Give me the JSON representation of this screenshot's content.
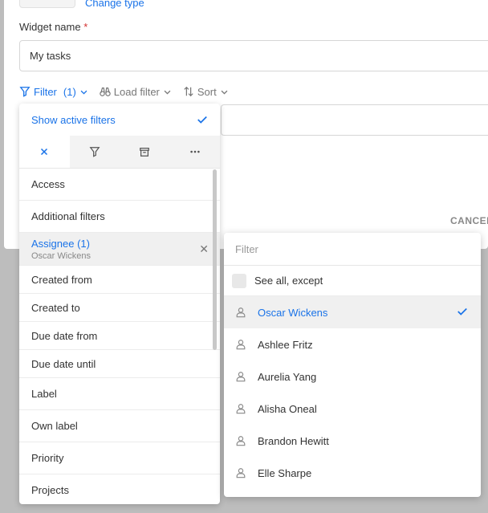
{
  "dialog": {
    "change_type_link": "Change type",
    "widget_name_label": "Widget name",
    "required_marker": "*",
    "widget_name_value": "My tasks",
    "cancel_button": "CANCEL"
  },
  "toolbar": {
    "filter_label": "Filter",
    "filter_count": "(1)",
    "load_filter_label": "Load filter",
    "sort_label": "Sort"
  },
  "filter_panel": {
    "show_active_label": "Show active filters",
    "tabs": [
      "close-icon",
      "filter-icon",
      "archive-icon",
      "more-icon"
    ],
    "items": [
      {
        "label": "Access"
      },
      {
        "label": "Additional filters"
      },
      {
        "label": "Assignee (1)",
        "sub": "Oscar Wickens"
      },
      {
        "label": "Created from"
      },
      {
        "label": "Created to"
      },
      {
        "label": "Due date from"
      },
      {
        "label": "Due date until"
      },
      {
        "label": "Label"
      },
      {
        "label": "Own label"
      },
      {
        "label": "Priority"
      },
      {
        "label": "Projects"
      }
    ]
  },
  "assignee_dropdown": {
    "search_placeholder": "Filter",
    "see_all_except_label": "See all, except",
    "users": [
      {
        "name": "Oscar Wickens",
        "selected": true
      },
      {
        "name": "Ashlee Fritz",
        "selected": false
      },
      {
        "name": "Aurelia Yang",
        "selected": false
      },
      {
        "name": "Alisha Oneal",
        "selected": false
      },
      {
        "name": "Brandon Hewitt",
        "selected": false
      },
      {
        "name": "Elle Sharpe",
        "selected": false
      }
    ]
  },
  "colors": {
    "accent": "#1a73e8",
    "overlay": "#bdbdbd",
    "required": "#d32f2f"
  }
}
